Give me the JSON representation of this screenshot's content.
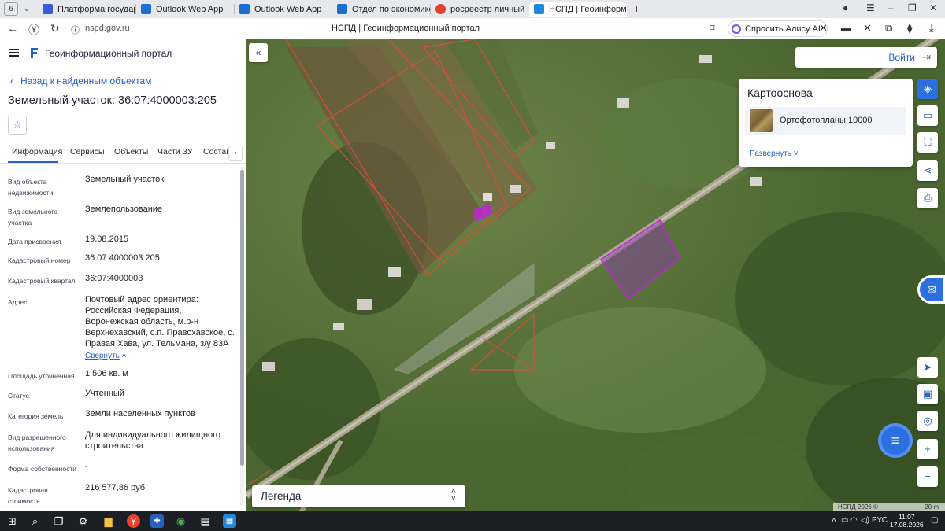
{
  "browser": {
    "tab_count": "6",
    "tabs": [
      {
        "label": "Платформа государстве",
        "color": "#3b5bdb"
      },
      {
        "label": "Outlook Web App",
        "color": "#1a6fd0"
      },
      {
        "label": "Outlook Web App",
        "color": "#1a6fd0"
      },
      {
        "label": "Отдел по экономике и уп",
        "color": "#1a6fd0"
      },
      {
        "label": "росреестр личный кабин",
        "color": "#e0402f"
      },
      {
        "label": "НСПД | Геоинформац",
        "color": "#1f88d8"
      }
    ],
    "url": "nspd.gov.ru",
    "page_title": "НСПД | Геоинформационный портал",
    "alice_label": "Спросить Алису AI"
  },
  "panel": {
    "brand": "Геоинформационный портал",
    "back_link": "Назад к найденным объектам",
    "title": "Земельный участок: 36:07:4000003:205",
    "tabs": [
      "Информация",
      "Сервисы",
      "Объекты",
      "Части ЗУ",
      "Состав"
    ],
    "props": [
      {
        "key": "Вид объекта недвижимости",
        "value": "Земельный участок"
      },
      {
        "key": "Вид земельного участка",
        "value": "Землепользование"
      },
      {
        "key": "Дата присвоения",
        "value": "19.08.2015"
      },
      {
        "key": "Кадастровый номер",
        "value": "36:07:4000003:205"
      },
      {
        "key": "Кадастровый квартал",
        "value": "36:07:4000003"
      },
      {
        "key": "Адрес",
        "value": "Почтовый адрес ориентира: Российская Федерация, Воронежская область, м.р-н Верхнехавский, с.п. Правохавское, с. Правая Хава, ул. Тельмана, з/у 83А"
      },
      {
        "key": "Площадь уточненная",
        "value": "1 506 кв. м"
      },
      {
        "key": "Статус",
        "value": "Учтенный"
      },
      {
        "key": "Категория земель",
        "value": "Земли населенных пунктов"
      },
      {
        "key": "Вид разрешенного использования",
        "value": "Для индивидуального жилищного строительства"
      },
      {
        "key": "Форма собственности",
        "value": "-"
      },
      {
        "key": "Кадастровая стоимость",
        "value": "216 577,86 руб."
      }
    ],
    "collapse_label": "Свернуть"
  },
  "map": {
    "login_label": "Войти",
    "basemap_title": "Картооснова",
    "basemap_layer": "Ортофотопланы 10000",
    "basemap_expand": "Развернуть",
    "legend_label": "Легенда",
    "attribution": "НСПД 2026 ©",
    "scale_label": "20 m",
    "accent_color": "#2c6fe0",
    "highlight_color": "#c41fe0"
  },
  "taskbar": {
    "language": "РУС",
    "time": "11:07",
    "date": "17.08.2026"
  }
}
